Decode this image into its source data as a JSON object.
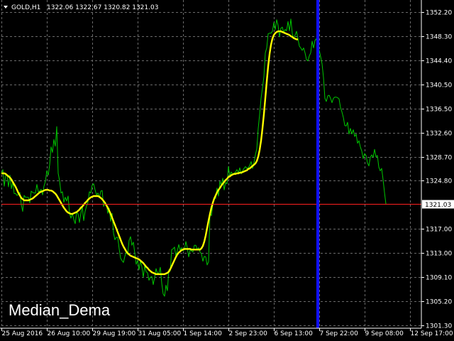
{
  "header": {
    "symbol": "GOLD,H1",
    "ohlc": "1322.06 1322.67 1320.82 1321.03"
  },
  "indicator_label": "Median_Dema",
  "colors": {
    "background": "#000000",
    "grid": "#6a6a6a",
    "price_line": "#00c800",
    "indicator_line": "#ffff00",
    "current_price_line": "#ff2020",
    "vertical_marker": "#1010ff",
    "axis_text": "#ffffff"
  },
  "chart_data": {
    "type": "line",
    "title": "GOLD,H1",
    "ylim": [
      1300.8,
      1354.2
    ],
    "y_ticks": [
      1352.2,
      1348.3,
      1344.4,
      1340.5,
      1336.5,
      1332.6,
      1328.7,
      1324.8,
      1321.03,
      1317.0,
      1313.0,
      1309.1,
      1305.2,
      1301.3
    ],
    "x_ticks": [
      "25 Aug 2016",
      "26 Aug 10:00",
      "29 Aug 19:00",
      "31 Aug 05:00",
      "1 Sep 14:00",
      "2 Sep 23:00",
      "6 Sep 13:00",
      "7 Sep 22:00",
      "9 Sep 08:00",
      "12 Sep 17:00"
    ],
    "x_tick_index": [
      0,
      32,
      64,
      96,
      128,
      160,
      192,
      224,
      256,
      288
    ],
    "current_price": 1321.03,
    "current_price_label": "1321.03",
    "marker_index": 223,
    "series": [
      {
        "role": "price",
        "values": [
          1326.0,
          1326.6,
          1323.9,
          1325.7,
          1325.7,
          1323.8,
          1325.7,
          1323.5,
          1324.6,
          1322.7,
          1322.7,
          1322.4,
          1322.6,
          1322.9,
          1320.9,
          1319.8,
          1322.4,
          1322.1,
          1322.1,
          1322.1,
          1321.2,
          1323.1,
          1322.9,
          1322.8,
          1322.8,
          1324.2,
          1323.0,
          1323.1,
          1323.4,
          1322.5,
          1323.9,
          1324.7,
          1326.4,
          1325.7,
          1327.4,
          1330.3,
          1329.4,
          1331.5,
          1330.4,
          1333.6,
          1326.0,
          1324.8,
          1322.8,
          1323.0,
          1321.3,
          1322.1,
          1321.5,
          1322.3,
          1319.5,
          1318.7,
          1319.5,
          1318.5,
          1317.8,
          1319.7,
          1319.4,
          1318.0,
          1319.5,
          1320.6,
          1318.3,
          1319.8,
          1320.7,
          1321.3,
          1323.0,
          1322.8,
          1324.1,
          1324.3,
          1323.3,
          1322.5,
          1322.8,
          1322.0,
          1323.1,
          1323.2,
          1320.6,
          1321.3,
          1320.9,
          1319.5,
          1320.3,
          1318.2,
          1319.5,
          1316.3,
          1315.2,
          1315.6,
          1315.6,
          1313.7,
          1312.2,
          1311.8,
          1311.5,
          1312.5,
          1313.2,
          1312.8,
          1315.1,
          1315.7,
          1314.3,
          1314.8,
          1313.0,
          1311.2,
          1311.8,
          1310.3,
          1311.8,
          1310.8,
          1309.1,
          1311.0,
          1310.0,
          1309.8,
          1308.6,
          1309.1,
          1309.2,
          1307.9,
          1309.1,
          1310.5,
          1309.7,
          1309.8,
          1310.7,
          1308.1,
          1306.4,
          1306.0,
          1307.8,
          1306.9,
          1310.3,
          1310.1,
          1313.6,
          1313.7,
          1314.0,
          1312.5,
          1313.4,
          1314.4,
          1313.5,
          1313.9,
          1313.4,
          1313.6,
          1314.9,
          1313.9,
          1312.4,
          1313.5,
          1313.4,
          1313.2,
          1314.3,
          1314.3,
          1313.6,
          1313.9,
          1313.2,
          1312.9,
          1311.7,
          1312.5,
          1312.4,
          1311.1,
          1311.6,
          1319.6,
          1319.1,
          1320.9,
          1321.9,
          1321.9,
          1323.6,
          1322.3,
          1324.7,
          1324.1,
          1325.2,
          1323.3,
          1324.5,
          1324.3,
          1327.1,
          1325.5,
          1326.2,
          1325.9,
          1326.0,
          1326.2,
          1326.6,
          1326.1,
          1326.9,
          1325.9,
          1326.4,
          1326.8,
          1327.1,
          1326.8,
          1326.9,
          1327.3,
          1327.9,
          1326.8,
          1327.7,
          1329.0,
          1330.0,
          1333.3,
          1335.6,
          1338.2,
          1339.9,
          1341.7,
          1345.6,
          1346.4,
          1348.7,
          1348.8,
          1348.8,
          1349.1,
          1350.5,
          1349.4,
          1351.0,
          1350.1,
          1348.2,
          1349.6,
          1349.8,
          1348.9,
          1349.4,
          1349.2,
          1350.7,
          1349.2,
          1351.1,
          1348.8,
          1347.9,
          1348.5,
          1349.1,
          1347.9,
          1346.7,
          1346.4,
          1346.0,
          1346.4,
          1345.6,
          1344.5,
          1344.3,
          1345.1,
          1345.6,
          1347.5,
          1346.4,
          1347.6,
          1347.9,
          1346.6,
          1346.0,
          1345.0,
          1343.8,
          1341.6,
          1338.2,
          1337.7,
          1338.6,
          1338.7,
          1338.2,
          1337.5,
          1338.2,
          1338.4,
          1338.4,
          1338.3,
          1338.1,
          1336.7,
          1336.0,
          1335.1,
          1333.8,
          1333.7,
          1334.3,
          1332.4,
          1333.3,
          1332.4,
          1333.1,
          1332.0,
          1332.4,
          1330.9,
          1331.3,
          1330.3,
          1329.6,
          1328.4,
          1329.2,
          1328.9,
          1327.7,
          1327.2,
          1328.6,
          1329.0,
          1328.6,
          1329.9,
          1328.7,
          1328.9,
          1327.0,
          1326.4,
          1326.8,
          1325.0,
          1322.9,
          1321.0
        ]
      },
      {
        "role": "indicator",
        "values": [
          1326.0,
          1326.0,
          1326.0,
          1325.9,
          1325.7,
          1325.5,
          1325.3,
          1325.0,
          1324.6,
          1324.2,
          1323.8,
          1323.3,
          1322.8,
          1322.4,
          1322.0,
          1321.8,
          1321.6,
          1321.6,
          1321.6,
          1321.6,
          1321.7,
          1321.8,
          1321.9,
          1322.1,
          1322.3,
          1322.5,
          1322.7,
          1322.9,
          1323.0,
          1323.1,
          1323.2,
          1323.3,
          1323.3,
          1323.3,
          1323.2,
          1323.2,
          1323.1,
          1322.9,
          1322.7,
          1322.4,
          1322.0,
          1321.6,
          1321.2,
          1320.8,
          1320.4,
          1320.1,
          1319.8,
          1319.6,
          1319.5,
          1319.4,
          1319.4,
          1319.5,
          1319.6,
          1319.7,
          1319.9,
          1320.1,
          1320.4,
          1320.6,
          1320.9,
          1321.2,
          1321.4,
          1321.7,
          1321.9,
          1322.1,
          1322.2,
          1322.3,
          1322.3,
          1322.3,
          1322.3,
          1322.2,
          1322.0,
          1321.8,
          1321.5,
          1321.2,
          1320.8,
          1320.4,
          1319.9,
          1319.4,
          1318.8,
          1318.2,
          1317.6,
          1317.0,
          1316.4,
          1315.8,
          1315.2,
          1314.6,
          1314.1,
          1313.7,
          1313.3,
          1313.0,
          1312.8,
          1312.6,
          1312.5,
          1312.4,
          1312.3,
          1312.2,
          1312.1,
          1312.0,
          1311.8,
          1311.6,
          1311.4,
          1311.1,
          1310.8,
          1310.6,
          1310.3,
          1310.1,
          1309.9,
          1309.8,
          1309.7,
          1309.6,
          1309.6,
          1309.6,
          1309.6,
          1309.6,
          1309.6,
          1309.6,
          1309.7,
          1309.8,
          1310.0,
          1310.4,
          1310.9,
          1311.4,
          1311.9,
          1312.4,
          1312.8,
          1313.1,
          1313.3,
          1313.5,
          1313.6,
          1313.7,
          1313.7,
          1313.7,
          1313.7,
          1313.7,
          1313.6,
          1313.6,
          1313.6,
          1313.6,
          1313.6,
          1313.6,
          1313.6,
          1313.8,
          1314.2,
          1314.9,
          1315.9,
          1317.1,
          1318.3,
          1319.4,
          1320.4,
          1321.2,
          1321.9,
          1322.4,
          1322.9,
          1323.3,
          1323.6,
          1324.0,
          1324.3,
          1324.6,
          1324.9,
          1325.1,
          1325.4,
          1325.5,
          1325.7,
          1325.8,
          1325.9,
          1325.9,
          1326.0,
          1326.0,
          1326.1,
          1326.1,
          1326.2,
          1326.3,
          1326.4,
          1326.5,
          1326.7,
          1326.8,
          1327.0,
          1327.2,
          1327.4,
          1327.6,
          1328.0,
          1328.7,
          1329.8,
          1331.3,
          1333.3,
          1335.6,
          1338.2,
          1340.9,
          1343.4,
          1345.4,
          1346.9,
          1347.9,
          1348.5,
          1348.8,
          1349.0,
          1349.1,
          1349.1,
          1349.1,
          1349.0,
          1348.9,
          1348.8,
          1348.7,
          1348.6,
          1348.5,
          1348.3,
          1348.2,
          1348.0,
          1347.9,
          1347.8,
          1347.8
        ]
      }
    ]
  }
}
